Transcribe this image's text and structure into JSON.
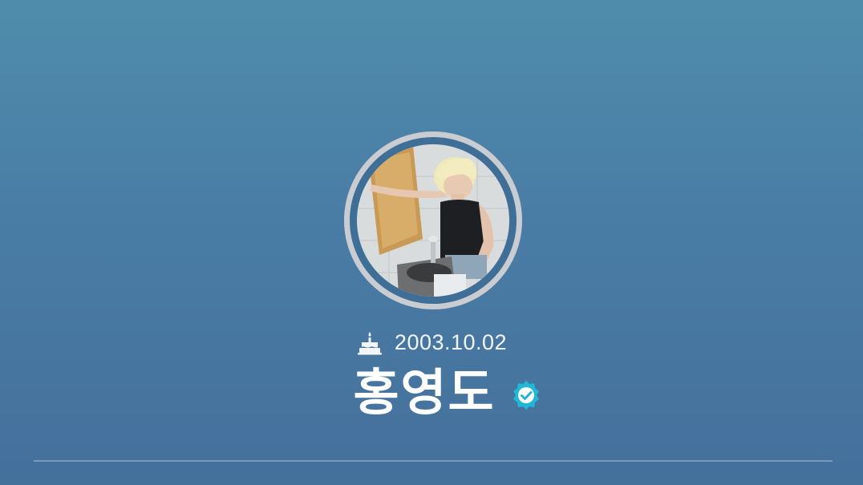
{
  "profile": {
    "birthday": "2003.10.02",
    "name": "홍영도",
    "verified": true,
    "avatar_icon": "profile-photo",
    "birthday_icon": "cake-icon",
    "verified_icon": "verified-badge-icon"
  },
  "colors": {
    "background_top": "#4f8cab",
    "background_bottom": "#44709c",
    "avatar_ring": "#c9cdd2",
    "verified_badge": "#1fb9d6",
    "text": "#ffffff"
  }
}
